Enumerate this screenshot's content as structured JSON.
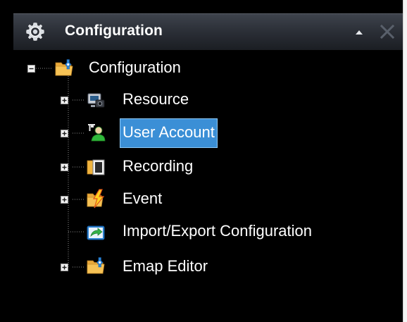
{
  "panel": {
    "title": "Configuration",
    "icon": "gear-icon",
    "controls": [
      "collapse-icon",
      "close-icon"
    ]
  },
  "tree": {
    "root": {
      "label": "Configuration",
      "icon": "config-folder-icon",
      "expanded": true
    },
    "items": [
      {
        "label": "Resource",
        "icon": "resource-icon",
        "expandable": true,
        "selected": false
      },
      {
        "label": "User Account",
        "icon": "user-account-icon",
        "expandable": true,
        "selected": true
      },
      {
        "label": "Recording",
        "icon": "recording-icon",
        "expandable": true,
        "selected": false
      },
      {
        "label": "Event",
        "icon": "event-icon",
        "expandable": true,
        "selected": false
      },
      {
        "label": "Import/Export Configuration",
        "icon": "import-export-icon",
        "expandable": false,
        "selected": false
      },
      {
        "label": "Emap Editor",
        "icon": "emap-editor-icon",
        "expandable": true,
        "selected": false
      }
    ]
  },
  "colors": {
    "background": "#000000",
    "header_top": "#3e434c",
    "header_bottom": "#1b1e23",
    "selection": "#3b8fd6",
    "selection_border": "#8cc8f5",
    "text": "#ffffff"
  }
}
